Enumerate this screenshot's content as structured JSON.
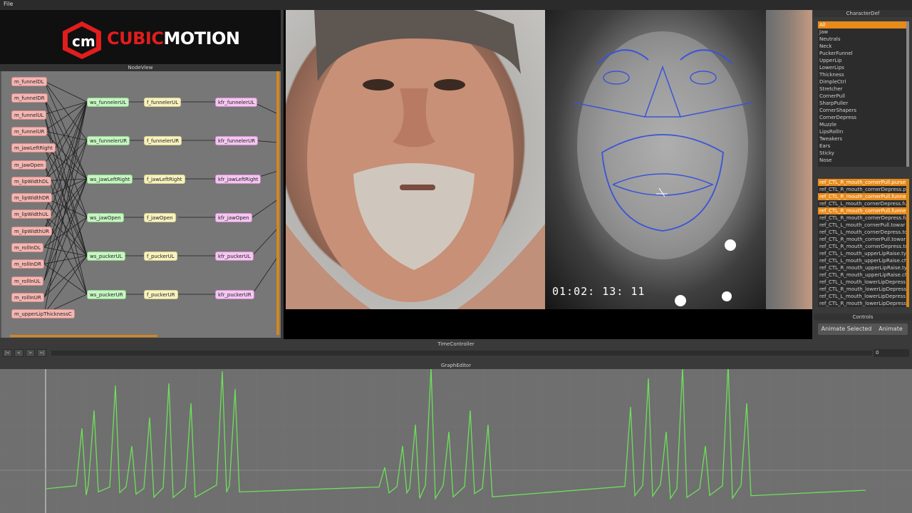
{
  "menu": {
    "file": "File"
  },
  "logo": {
    "prefix": "CUBIC",
    "suffix": "MOTION"
  },
  "nodeview": {
    "title": "NodeView",
    "m_nodes": [
      "m_funnelDL",
      "m_funnelDR",
      "m_funnelUL",
      "m_funnelUR",
      "m_jawLeftRight",
      "m_jawOpen",
      "m_lipWidthDL",
      "m_lipWidthDR",
      "m_lipWidthUL",
      "m_lipWidthUR",
      "m_rollInDL",
      "m_rollInDR",
      "m_rollInUL",
      "m_rollInUR",
      "m_upperLipThicknessC"
    ],
    "ws_nodes": [
      "ws_funnelerUL",
      "ws_funnelerUR",
      "ws_jawLeftRight",
      "ws_jawOpen",
      "ws_puckerUL",
      "ws_puckerUR"
    ],
    "f_nodes": [
      "f_funnelerUL",
      "f_funnelerUR",
      "f_jawLeftRight",
      "f_jawOpen",
      "f_puckerUL",
      "f_puckerUR"
    ],
    "kfr_nodes": [
      "kfr_funnelerUL",
      "kfr_funnelerUR",
      "kfr_jawLeftRight",
      "kfr_jawOpen",
      "kfr_puckerUL",
      "kfr_puckerUR"
    ]
  },
  "viewport": {
    "timecode": "01:02: 13: 11"
  },
  "chardef": {
    "title": "CharacterDef",
    "groups": [
      "All",
      "Jaw",
      "Neutrals",
      "Neck",
      "PuckerFunnel",
      "UpperLip",
      "LowerLips",
      "Thickness",
      "DimpleCtrl",
      "Stretcher",
      "CornerPull",
      "SharpPuller",
      "CornerShapers",
      "CornerDepress",
      "Muzzle",
      "LipsRollIn",
      "Tweakers",
      "Ears",
      "Sticky",
      "Nose"
    ],
    "selected_group": "All",
    "controls": [
      {
        "label": "ref_CTL_R_mouth_cornerPull.purse",
        "selected": true
      },
      {
        "label": "ref_CTL_R_mouth_cornerDepress.p",
        "selected": false
      },
      {
        "label": "ref_CTL_R_mouth_cornerPull.funnel",
        "selected": true
      },
      {
        "label": "ref_CTL_L_mouth_cornerDepress.fu",
        "selected": false
      },
      {
        "label": "ref_CTL_R_mouth_cornerPull.funne",
        "selected": true
      },
      {
        "label": "ref_CTL_R_mouth_cornerDepress.fu",
        "selected": false
      },
      {
        "label": "ref_CTL_L_mouth_cornerPull.towar",
        "selected": false
      },
      {
        "label": "ref_CTL_L_mouth_cornerDepress.to",
        "selected": false
      },
      {
        "label": "ref_CTL_R_mouth_cornerPull.towar",
        "selected": false
      },
      {
        "label": "ref_CTL_R_mouth_cornerDepress.to",
        "selected": false
      },
      {
        "label": "ref_CTL_L_mouth_upperLipRaise.ty",
        "selected": false
      },
      {
        "label": "ref_CTL_L_mouth_upperLipRaise.ch",
        "selected": false
      },
      {
        "label": "ref_CTL_R_mouth_upperLipRaise.ty",
        "selected": false
      },
      {
        "label": "ref_CTL_R_mouth_upperLipRaise.ch",
        "selected": false
      },
      {
        "label": "ref_CTL_L_mouth_lowerLipDepress.",
        "selected": false
      },
      {
        "label": "ref_CTL_R_mouth_lowerLipDepress.",
        "selected": false
      },
      {
        "label": "ref_CTL_L_mouth_lowerLipDepress",
        "selected": false
      },
      {
        "label": "ref_CTL_R_mouth_lowerLipDepress",
        "selected": false
      }
    ]
  },
  "controls": {
    "title": "Controls",
    "animate_selected": "Animate Selected",
    "animate": "Animate"
  },
  "timecontroller": {
    "title": "TimeController",
    "btn_first": "|<",
    "btn_prev": "<",
    "btn_next": ">",
    "btn_last": ">|",
    "frame": "0"
  },
  "grapheditor": {
    "title": "GraphEditor"
  },
  "colors": {
    "accent": "#e88a1a",
    "curve": "#6de05a",
    "graph_bg": "#6f6f6f"
  }
}
